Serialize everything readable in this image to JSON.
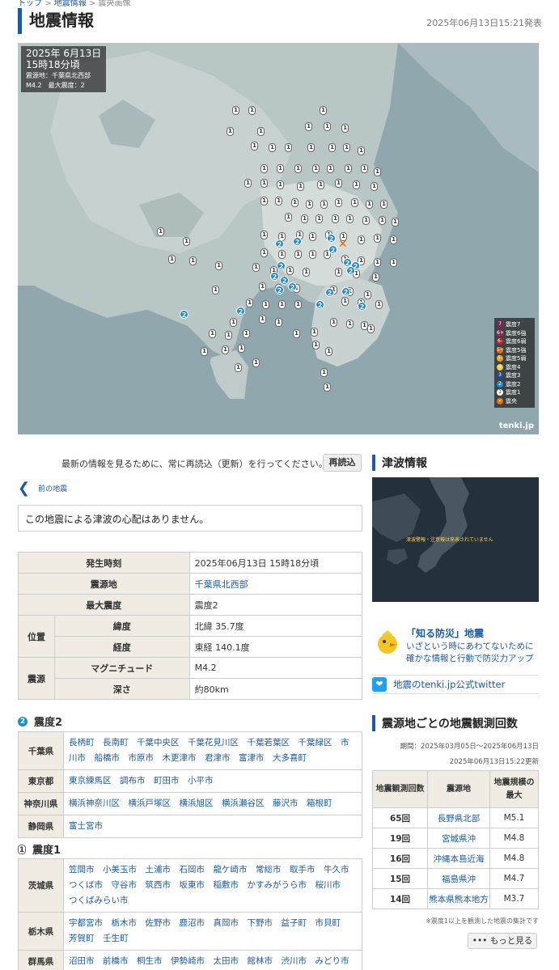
{
  "breadcrumb": {
    "home": "トップ",
    "sep1": ">",
    "parent": "地震情報",
    "sep2": ">",
    "current": "震央画像"
  },
  "header": {
    "title": "地震情報",
    "announced": "2025年06月13日15:21発表"
  },
  "map": {
    "date": "2025年 6月13日",
    "time": "15時18分頃",
    "epicenter_line": "震源地：千葉県北西部",
    "mag_line": "M4.2　最大震度：2",
    "brand": "tenki.jp",
    "legend": [
      {
        "sym": "7",
        "label": "震度7",
        "color": "#8a1d5c"
      },
      {
        "sym": "6+",
        "label": "震度6強",
        "color": "#a0205a"
      },
      {
        "sym": "6-",
        "label": "震度6弱",
        "color": "#d0202a"
      },
      {
        "sym": "5+",
        "label": "震度5強",
        "color": "#e36a16"
      },
      {
        "sym": "5-",
        "label": "震度5弱",
        "color": "#e9a020"
      },
      {
        "sym": "4",
        "label": "震度4",
        "color": "#e8d040"
      },
      {
        "sym": "3",
        "label": "震度3",
        "color": "#1f4aa0"
      },
      {
        "sym": "2",
        "label": "震度2",
        "color": "#1e8bd0"
      },
      {
        "sym": "1",
        "label": "震度1",
        "color": "#ffffff"
      },
      {
        "sym": "×",
        "label": "震央",
        "color": "#f06a00"
      }
    ]
  },
  "reload": {
    "text": "最新の情報を見るために、常に再読込（更新）を行ってください。",
    "button": "再読込"
  },
  "prev_link": "前の地震",
  "tsunami_notice": "この地震による津波の心配はありません。",
  "info": {
    "rows": [
      {
        "label": "発生時刻",
        "value": "2025年06月13日 15時18分頃"
      },
      {
        "label": "震源地",
        "value": "千葉県北西部"
      },
      {
        "label": "最大震度",
        "value": "震度2"
      }
    ],
    "position_label": "位置",
    "lat_label": "緯度",
    "lat": "北緯 35.7度",
    "lon_label": "経度",
    "lon": "東経 140.1度",
    "source_label": "震源",
    "mag_label": "マグニチュード",
    "mag": "M4.2",
    "depth_label": "深さ",
    "depth": "約80km"
  },
  "intensity2": {
    "icon": "2",
    "heading": "震度2",
    "prefs": [
      {
        "pref": "千葉県",
        "cities": "長柄町　長南町　千葉中央区　千葉花見川区　千葉若葉区　千葉緑区　市川市　船橋市　市原市　木更津市　君津市　富津市　大多喜町"
      },
      {
        "pref": "東京都",
        "cities": "東京練馬区　調布市　町田市　小平市"
      },
      {
        "pref": "神奈川県",
        "cities": "横浜神奈川区　横浜戸塚区　横浜旭区　横浜瀬谷区　藤沢市　箱根町"
      },
      {
        "pref": "静岡県",
        "cities": "富士宮市"
      }
    ]
  },
  "intensity1": {
    "icon": "1",
    "heading": "震度1",
    "prefs": [
      {
        "pref": "茨城県",
        "cities": "笠間市　小美玉市　土浦市　石岡市　龍ケ崎市　常総市　取手市　牛久市　つくば市　守谷市　筑西市　坂東市　稲敷市　かすみがうら市　桜川市　つくばみらい市"
      },
      {
        "pref": "栃木県",
        "cities": "宇都宮市　栃木市　佐野市　鹿沼市　真岡市　下野市　益子町　市貝町　芳賀町　壬生町"
      },
      {
        "pref": "群馬県",
        "cities": "沼田市　前橋市　桐生市　伊勢崎市　太田市　館林市　渋川市　みどり市"
      }
    ]
  },
  "tsunami": {
    "heading": "津波情報",
    "map_text": "津波警報・注意報は発表されていません"
  },
  "bousai": {
    "title": "「知る防災」地震",
    "line1": "いざという時にあわてないために",
    "line2": "確かな情報と行動で防災力アップ"
  },
  "twitter": {
    "label": "地震のtenki.jp公式twitter"
  },
  "counts": {
    "heading": "震源地ごとの地震観測回数",
    "period": "期間：2025年03月05日～2025年06月13日",
    "updated": "2025年06月13日15:22更新",
    "col_count": "地震観測回数",
    "col_place": "震源地",
    "col_max": "地震規模の最大",
    "rows": [
      {
        "count": "65回",
        "place": "長野県北部",
        "max": "M5.1"
      },
      {
        "count": "19回",
        "place": "宮城県沖",
        "max": "M4.8"
      },
      {
        "count": "16回",
        "place": "沖縄本島近海",
        "max": "M4.8"
      },
      {
        "count": "15回",
        "place": "福島県沖",
        "max": "M4.7"
      },
      {
        "count": "14回",
        "place": "熊本県熊本地方",
        "max": "M3.7"
      }
    ],
    "note": "※震度1以上を観測した地震の集計です",
    "more": "もっと見る"
  }
}
